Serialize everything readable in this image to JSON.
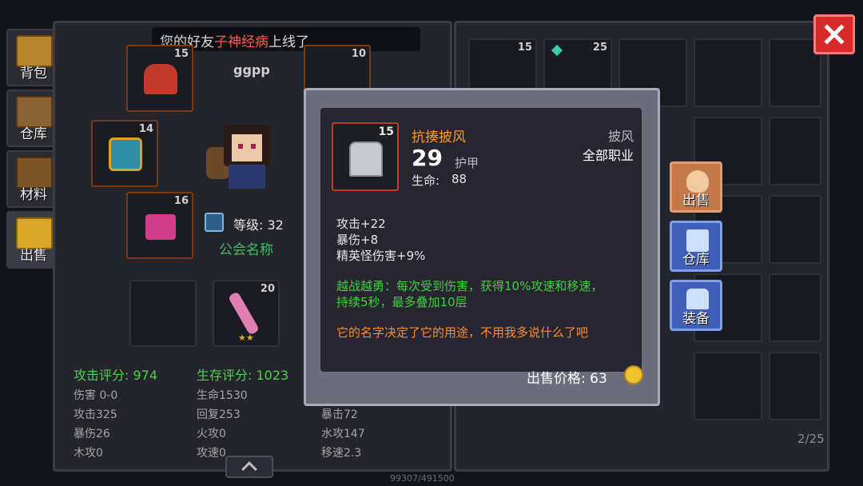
{
  "notification": {
    "prefix": "您的好友",
    "friend_name": "子神经病",
    "suffix": "上线了"
  },
  "side_tabs": [
    {
      "label": "背包",
      "icon": "backpack-chest-icon"
    },
    {
      "label": "仓库",
      "icon": "warehouse-crate-icon"
    },
    {
      "label": "材料",
      "icon": "materials-crate-icon"
    },
    {
      "label": "出售",
      "icon": "sell-coins-icon"
    }
  ],
  "character": {
    "name": "ggpp",
    "level_label": "等级: 32",
    "guild_label": "公会名称",
    "equip_counts": {
      "head": "15",
      "tl2": "10",
      "chest": "14",
      "feet": "16",
      "weapon": "20"
    },
    "weapon_stars": "★★",
    "exp": "99307/491500",
    "attack_score": "攻击评分: 974",
    "survival_score": "生存评分: 1023",
    "stats_col1": [
      "伤害 0-0",
      "攻击325",
      "暴伤26",
      "木攻0"
    ],
    "stats_col2": [
      "生命1530",
      "回复253",
      "火攻0",
      "攻速0"
    ],
    "stats_col3": [
      "暴击72",
      "水攻147",
      "移速2.3"
    ]
  },
  "inventory": {
    "slot1_count": "15",
    "slot2_count": "25",
    "page": "2/25"
  },
  "tooltip": {
    "item_count": "15",
    "item_name": "抗揍披风",
    "armor_value": "29",
    "armor_label": "护甲",
    "hp_label": "生命:",
    "hp_value": "88",
    "type": "披风",
    "class": "全部职业",
    "bonus1": "攻击+22",
    "bonus2": "暴伤+8",
    "bonus3": "精英怪伤害+9%",
    "skill_line1": "越战越勇：每次受到伤害，获得10%攻速和移速，",
    "skill_line2": "持续5秒，最多叠加10层",
    "flavor": "它的名字决定了它的用途，不用我多说什么了吧",
    "price_label": "出售价格: 63"
  },
  "actions": {
    "sell": "出售",
    "store": "仓库",
    "equip": "装备"
  },
  "colors": {
    "accent_orange": "#ff9a1f",
    "skill_green": "#3fd03f",
    "flavor_orange": "#ff8c28",
    "close_red": "#d92a2a"
  }
}
